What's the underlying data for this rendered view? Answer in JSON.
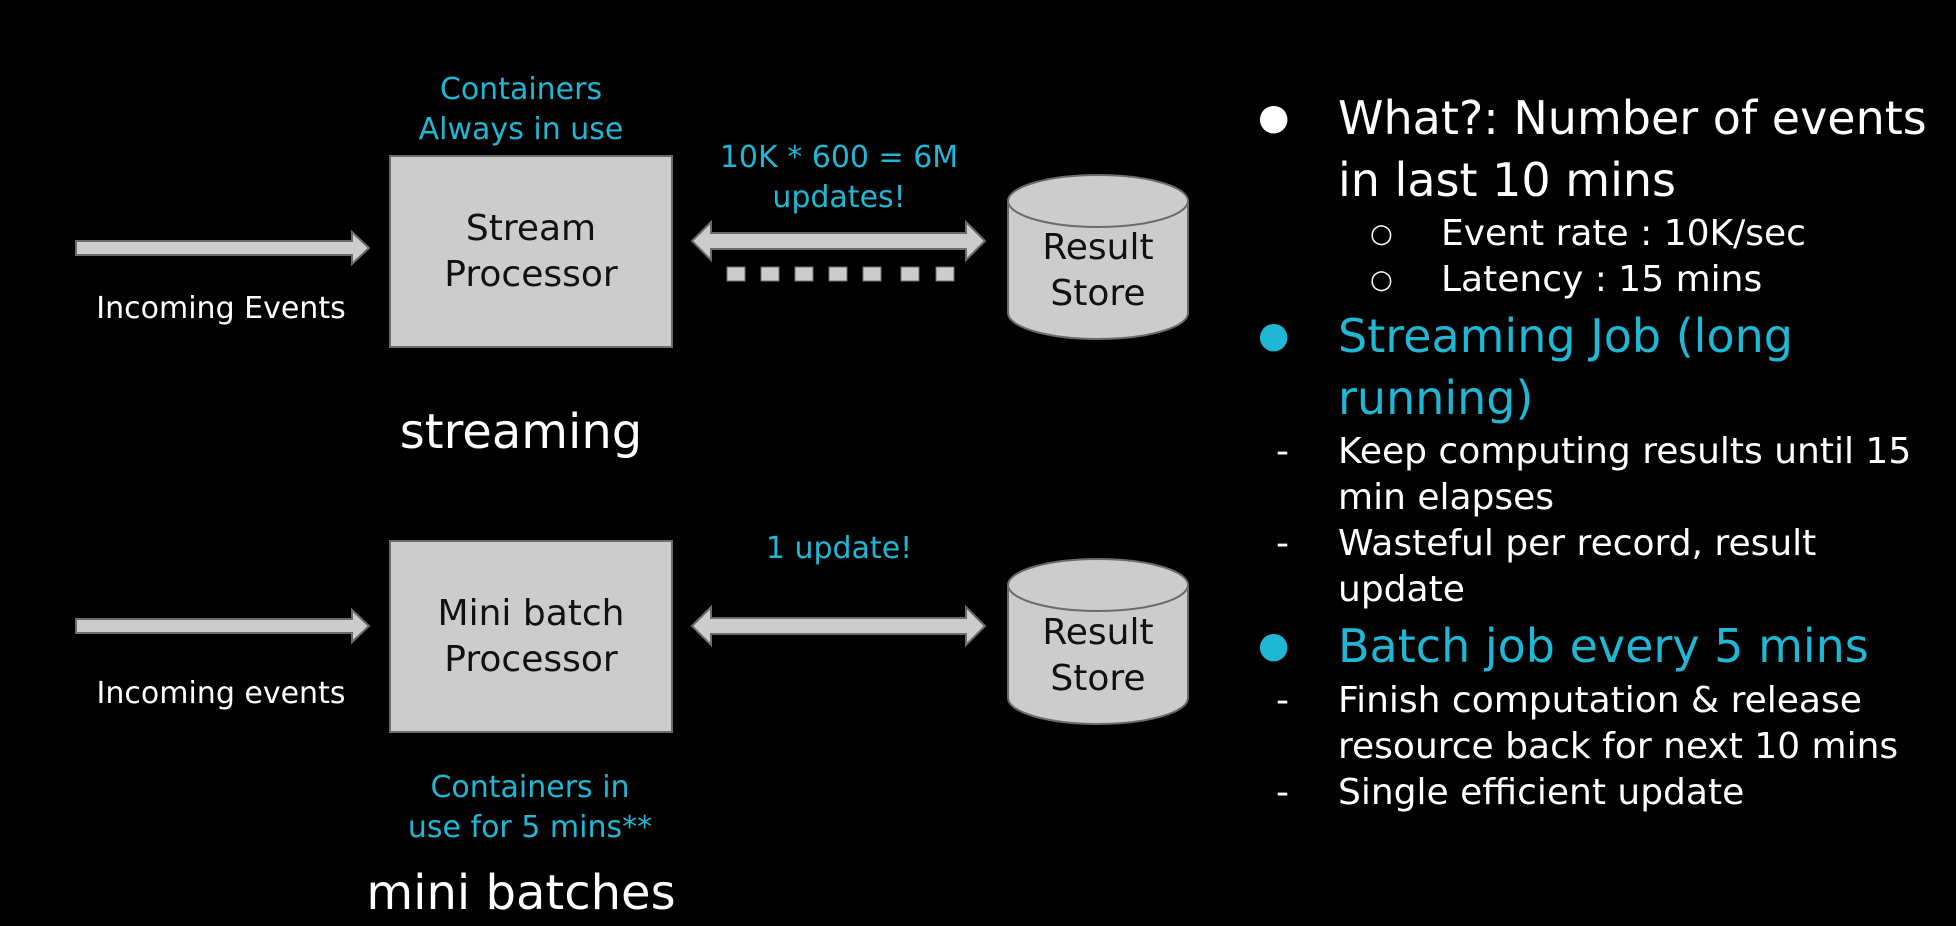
{
  "colors": {
    "background": "#000000",
    "accent": "#1fb7d4",
    "box_fill": "#cccccc",
    "text": "#ffffff"
  },
  "streaming": {
    "input_label": "Incoming Events",
    "processor_line1": "Stream",
    "processor_line2": "Processor",
    "containers_line1": "Containers",
    "containers_line2": "Always in use",
    "updates_line1": "10K * 600 = 6M",
    "updates_line2": "updates!",
    "store_line1": "Result",
    "store_line2": "Store",
    "caption": "streaming"
  },
  "mini_batch": {
    "input_label": "Incoming events",
    "processor_line1": "Mini batch",
    "processor_line2": "Processor",
    "updates_label": "1 update!",
    "store_line1": "Result",
    "store_line2": "Store",
    "containers_line1": "Containers in",
    "containers_line2": "use for 5 mins**",
    "caption": "mini batches"
  },
  "bullets": {
    "what_line1": "What?: Number of events",
    "what_line2": "in last 10 mins",
    "event_rate": "Event rate : 10K/sec",
    "latency": "Latency : 15 mins",
    "streaming_job_line1": "Streaming Job (long",
    "streaming_job_line2": "running)",
    "stream_point1_line1": "Keep computing results until 15",
    "stream_point1_line2": "min elapses",
    "stream_point2_line1": "Wasteful per record, result",
    "stream_point2_line2": "update",
    "batch_job": "Batch job every 5 mins",
    "batch_point1_line1": "Finish computation & release",
    "batch_point1_line2": "resource back for next 10 mins",
    "batch_point2": "Single efficient update",
    "bullet_glyph": "●",
    "sub_bullet_glyph": "○",
    "dash_glyph": "-"
  }
}
